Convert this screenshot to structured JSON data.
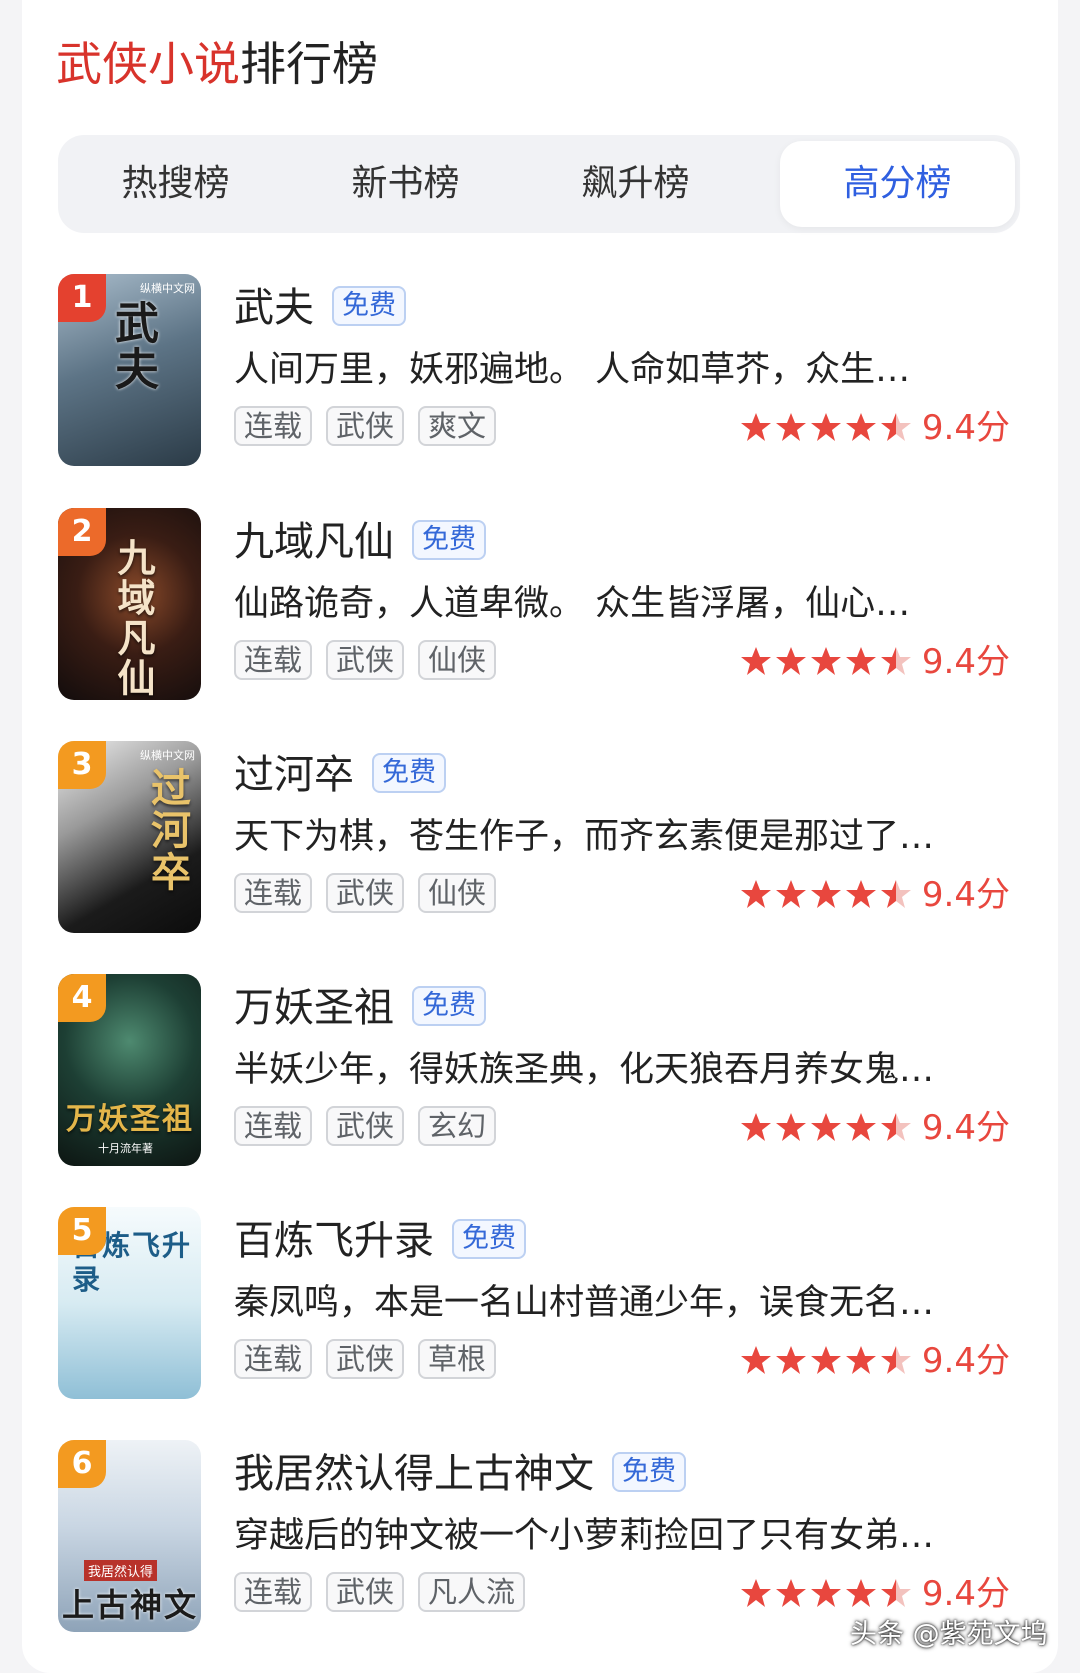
{
  "header": {
    "title_accent": "武侠小说",
    "title_rest": "排行榜"
  },
  "tabs": [
    {
      "label": "热搜榜",
      "active": false
    },
    {
      "label": "新书榜",
      "active": false
    },
    {
      "label": "飙升榜",
      "active": false
    },
    {
      "label": "高分榜",
      "active": true
    }
  ],
  "colors": {
    "accent_red": "#d8332b",
    "active_tab_blue": "#2f5fe0",
    "star_red": "#e8473e",
    "rank_top_red": "#e4412f",
    "rank_orange": "#f39a20"
  },
  "books": [
    {
      "rank": "1",
      "title": "武夫",
      "badge": "免费",
      "desc": "人间万里，妖邪遍地。 人命如草芥，众生…",
      "tags": [
        "连载",
        "武侠",
        "爽文"
      ],
      "stars": 4.5,
      "score": "9.4分",
      "cover_text": "武夫",
      "cover_publisher": "纵横中文网"
    },
    {
      "rank": "2",
      "title": "九域凡仙",
      "badge": "免费",
      "desc": "仙路诡奇，人道卑微。 众生皆浮屠，仙心…",
      "tags": [
        "连载",
        "武侠",
        "仙侠"
      ],
      "stars": 4.5,
      "score": "9.4分",
      "cover_text": "九域凡仙",
      "cover_publisher": ""
    },
    {
      "rank": "3",
      "title": "过河卒",
      "badge": "免费",
      "desc": "天下为棋，苍生作子，而齐玄素便是那过了…",
      "tags": [
        "连载",
        "武侠",
        "仙侠"
      ],
      "stars": 4.5,
      "score": "9.4分",
      "cover_text": "过河卒",
      "cover_publisher": "纵横中文网"
    },
    {
      "rank": "4",
      "title": "万妖圣祖",
      "badge": "免费",
      "desc": "半妖少年，得妖族圣典，化天狼吞月养女鬼…",
      "tags": [
        "连载",
        "武侠",
        "玄幻"
      ],
      "stars": 4.5,
      "score": "9.4分",
      "cover_text": "万妖圣祖",
      "cover_publisher": "十月流年著"
    },
    {
      "rank": "5",
      "title": "百炼飞升录",
      "badge": "免费",
      "desc": "秦凤鸣，本是一名山村普通少年，误食无名…",
      "tags": [
        "连载",
        "武侠",
        "草根"
      ],
      "stars": 4.5,
      "score": "9.4分",
      "cover_text": "百炼飞升录",
      "cover_publisher": ""
    },
    {
      "rank": "6",
      "title": "我居然认得上古神文",
      "badge": "免费",
      "desc": "穿越后的钟文被一个小萝莉捡回了只有女弟…",
      "tags": [
        "连载",
        "武侠",
        "凡人流"
      ],
      "stars": 4.5,
      "score": "9.4分",
      "cover_text": "上古神文",
      "cover_publisher": "我居然认得"
    }
  ],
  "watermark": "头条 @紫苑文坞"
}
